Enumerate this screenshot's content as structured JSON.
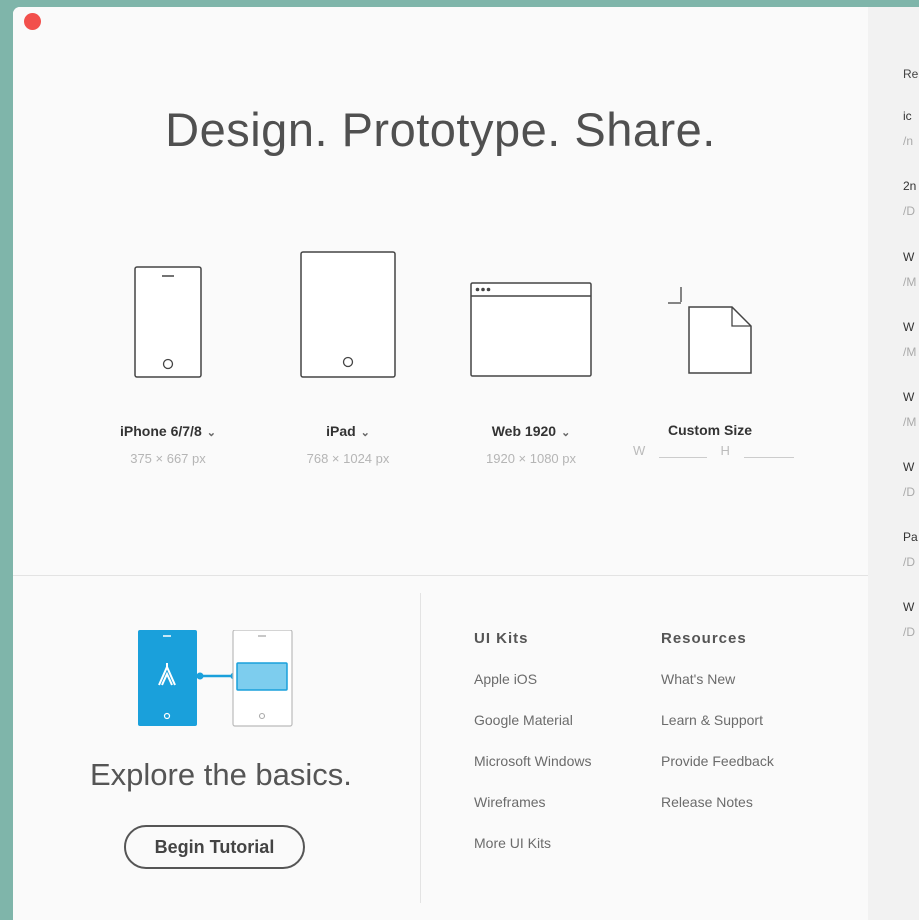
{
  "headline": "Design. Prototype. Share.",
  "presets": [
    {
      "name": "iPhone 6/7/8",
      "size": "375 × 667 px"
    },
    {
      "name": "iPad",
      "size": "768 × 1024 px"
    },
    {
      "name": "Web 1920",
      "size": "1920 × 1080 px"
    },
    {
      "name": "Custom Size",
      "w_label": "W",
      "h_label": "H"
    }
  ],
  "explore": {
    "title": "Explore the basics.",
    "button": "Begin Tutorial"
  },
  "ui_kits": {
    "title": "UI Kits",
    "items": [
      "Apple iOS",
      "Google Material",
      "Microsoft Windows",
      "Wireframes",
      "More UI Kits"
    ]
  },
  "resources": {
    "title": "Resources",
    "items": [
      "What's New",
      "Learn & Support",
      "Provide Feedback",
      "Release Notes"
    ]
  },
  "recent": {
    "title": "Re",
    "files": [
      {
        "name": "ic",
        "path": "/n"
      },
      {
        "name": "2n",
        "path": "/D"
      },
      {
        "name": "W",
        "path": "/M"
      },
      {
        "name": "W",
        "path": "/M"
      },
      {
        "name": "W",
        "path": "/M"
      },
      {
        "name": "W",
        "path": "/D"
      },
      {
        "name": "Pa",
        "path": "/D"
      },
      {
        "name": "W",
        "path": "/D"
      }
    ]
  },
  "colors": {
    "accent": "#1aa0db",
    "close": "#f2504c",
    "background": "#7fb5aa"
  }
}
